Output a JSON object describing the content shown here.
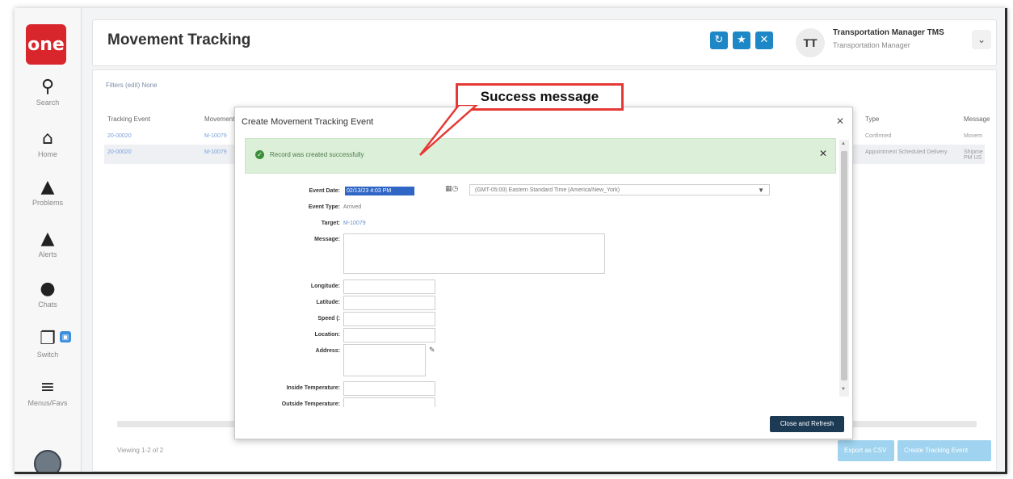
{
  "app": {
    "logo_text": "one",
    "page_title": "Movement Tracking",
    "header_actions": [
      "refresh-icon",
      "star-icon",
      "close-icon"
    ],
    "user": {
      "initials": "TT",
      "name": "Transportation Manager TMS",
      "role": "Transportation Manager"
    }
  },
  "sidebar": {
    "items": [
      {
        "label": "Search",
        "icon": "search-icon",
        "glyph": "🔍"
      },
      {
        "label": "Home",
        "icon": "home-icon",
        "glyph": "⌂"
      },
      {
        "label": "Problems",
        "icon": "warning-icon",
        "glyph": "⚠"
      },
      {
        "label": "Alerts",
        "icon": "bell-icon",
        "glyph": "🔔"
      },
      {
        "label": "Chats",
        "icon": "chat-icon",
        "glyph": "💬"
      },
      {
        "label": "Switch",
        "icon": "switch-icon",
        "glyph": "❐"
      },
      {
        "label": "Menus/Favs",
        "icon": "menu-icon",
        "glyph": "≡"
      }
    ]
  },
  "table": {
    "filters_text": "Filters (edit)  None",
    "columns": [
      "Tracking Event",
      "Movement",
      "Type",
      "Message"
    ],
    "rows": [
      {
        "event": "20-00020",
        "movement": "M-10079",
        "type": "Confirmed",
        "message": "Movem"
      },
      {
        "event": "20-00020",
        "movement": "M-10079",
        "type": "Appointment Scheduled Delivery",
        "message": "Shipme PM US"
      }
    ],
    "paging": "Viewing 1-2 of 2",
    "export_label": "Export as CSV",
    "create_label": "Create Tracking Event"
  },
  "modal": {
    "title": "Create Movement Tracking Event",
    "success_message": "Record was created successfully",
    "fields": {
      "event_date_label": "Event Date:",
      "event_date_value": "02/13/23 4:03 PM",
      "timezone_value": "(GMT-05:00) Eastern Standard Time (America/New_York)",
      "event_type_label": "Event Type:",
      "event_type_value": "Arrived",
      "target_label": "Target:",
      "target_value": "M-10079",
      "message_label": "Message:",
      "longitude_label": "Longitude:",
      "latitude_label": "Latitude:",
      "speed_label": "Speed (:",
      "location_label": "Location:",
      "address_label": "Address:",
      "inside_temp_label": "Inside Temperature:",
      "outside_temp_label": "Outside Temperature:"
    },
    "close_refresh_label": "Close and Refresh"
  },
  "annotation": {
    "callout_text": "Success message",
    "color": "#e53935"
  },
  "colors": {
    "brand_red": "#d9262c",
    "accent_blue": "#1e88c7",
    "success_bg": "#dcefd8",
    "dark_button": "#1d3a55"
  }
}
